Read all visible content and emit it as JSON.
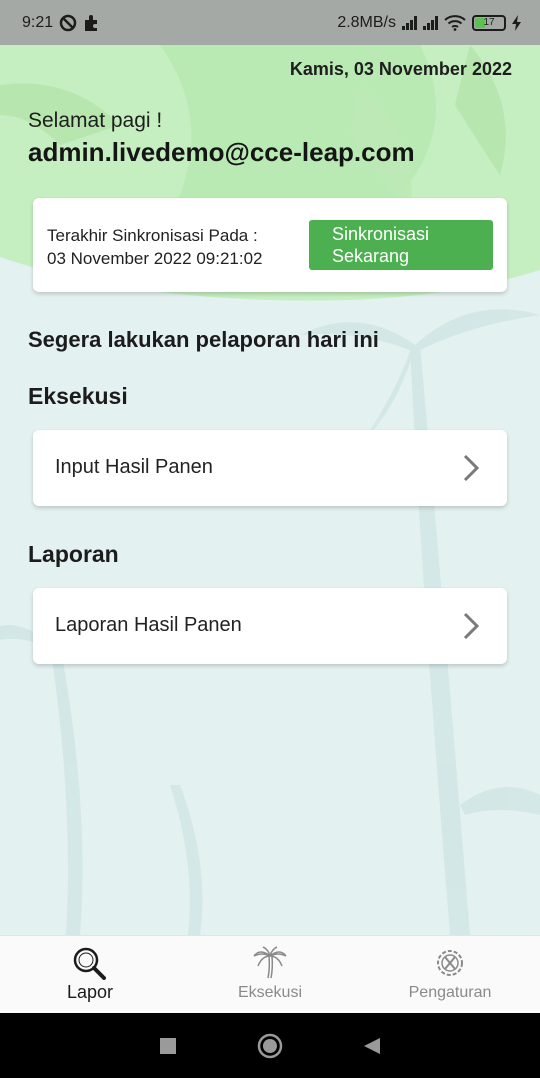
{
  "status_bar": {
    "time": "9:21",
    "network_speed": "2.8MB/s",
    "battery_level": "17",
    "icons": [
      "do-not-disturb-icon",
      "puzzle-icon",
      "signal-icon",
      "signal-icon",
      "wifi-icon",
      "battery-icon",
      "charging-icon"
    ]
  },
  "header": {
    "date": "Kamis, 03 November 2022",
    "greeting": "Selamat pagi !",
    "email": "admin.livedemo@cce-leap.com"
  },
  "sync": {
    "label_line1": "Terakhir Sinkronisasi Pada :",
    "label_line2": "03 November 2022 09:21:02",
    "button_line1": "Sinkronisasi",
    "button_line2": "Sekarang"
  },
  "notice": "Segera lakukan pelaporan hari ini",
  "sections": {
    "eksekusi": {
      "title": "Eksekusi",
      "item": "Input Hasil Panen"
    },
    "laporan": {
      "title": "Laporan",
      "item": "Laporan Hasil Panen"
    }
  },
  "bottom_nav": {
    "items": [
      {
        "label": "Lapor",
        "icon": "magnifier-icon",
        "active": true
      },
      {
        "label": "Eksekusi",
        "icon": "palm-tree-icon",
        "active": false
      },
      {
        "label": "Pengaturan",
        "icon": "settings-tools-icon",
        "active": false
      }
    ]
  },
  "colors": {
    "accent": "#4caf50",
    "header_green": "#c5efc0",
    "background": "#e3f1f0"
  }
}
